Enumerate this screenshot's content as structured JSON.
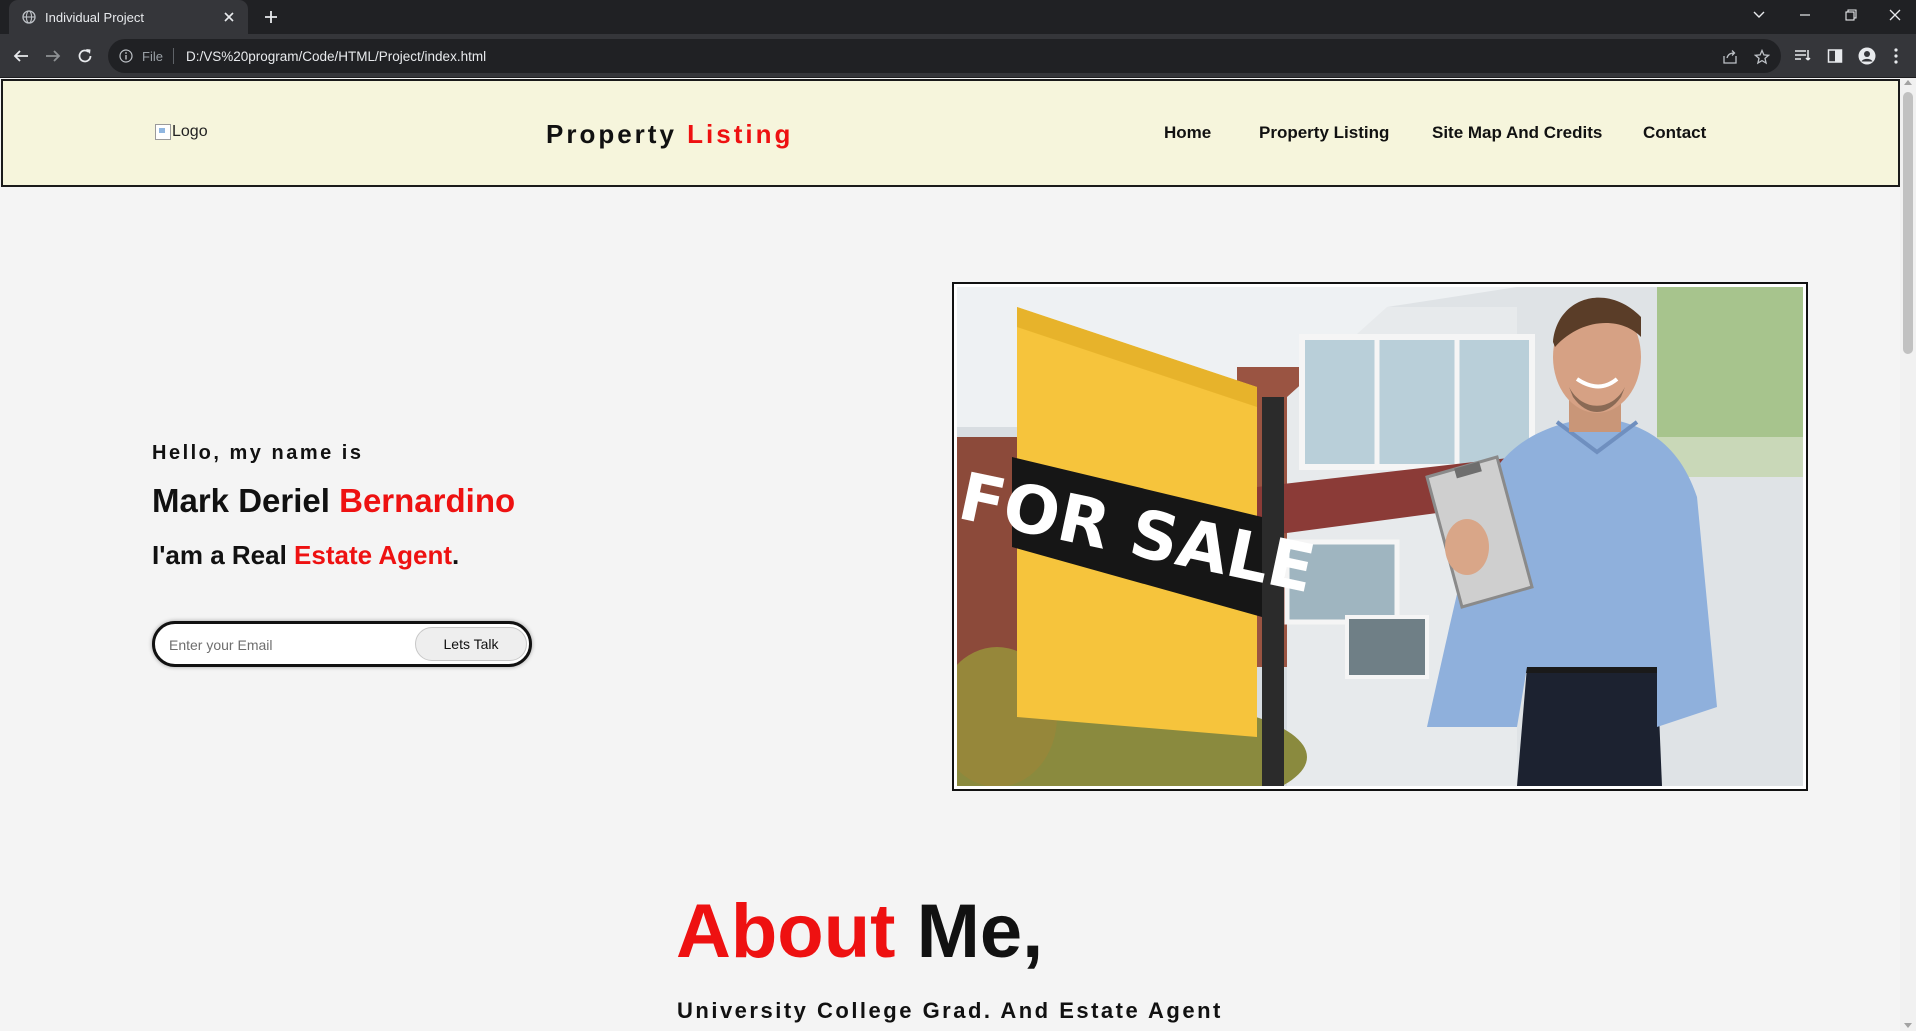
{
  "browser": {
    "tab_title": "Individual Project",
    "address_scheme": "File",
    "url": "D:/VS%20program/Code/HTML/Project/index.html"
  },
  "header": {
    "logo_alt": "Logo",
    "brand_first": "Property",
    "brand_second": "Listing",
    "nav": [
      "Home",
      "Property Listing",
      "Site Map And Credits",
      "Contact"
    ]
  },
  "hero": {
    "greeting": "Hello, my name is",
    "first_name": "Mark Deriel",
    "last_name": "Bernardino",
    "role_prefix": "I'am a Real",
    "role_highlight": "Estate Agent",
    "role_suffix": ".",
    "email_placeholder": "Enter your Email",
    "cta_label": "Lets Talk",
    "sign_text": "FOR SALE"
  },
  "about": {
    "title_highlight": "About",
    "title_rest": "Me,",
    "subtitle": "University College Grad. And Estate Agent"
  },
  "colors": {
    "accent": "#ee1111",
    "header_bg": "#f6f5dc",
    "page_bg": "#f4f4f4",
    "browser_dark": "#202124"
  },
  "icons": [
    "globe-icon",
    "close-icon",
    "plus-icon",
    "chevron-down-icon",
    "minimize-icon",
    "restore-icon",
    "back-arrow-icon",
    "forward-arrow-icon",
    "reload-icon",
    "info-icon",
    "share-icon",
    "star-icon",
    "reading-list-icon",
    "side-panel-icon",
    "profile-icon",
    "more-vert-icon"
  ]
}
